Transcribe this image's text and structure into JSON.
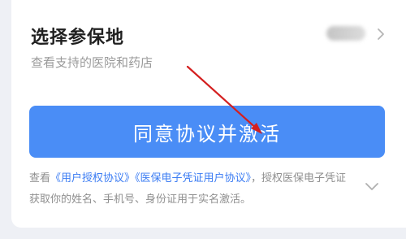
{
  "insurance_location": {
    "title": "选择参保地",
    "subtitle": "查看支持的医院和药店",
    "selected_value": "北京"
  },
  "activate_button": {
    "label": "同意协议并激活"
  },
  "agreement": {
    "prefix": "查看",
    "link1": "《用户授权协议》",
    "link2": "《医保电子凭证用户协议》",
    "suffix": "，授权医保电子凭证获取你的姓名、手机号、身份证用于实名激活。"
  },
  "colors": {
    "accent": "#4a8df6",
    "link": "#3b7cf3",
    "annotation_arrow": "#d42020"
  },
  "icons": {
    "region_chevron": "chevron-right-icon",
    "agreement_expand": "chevron-down-icon",
    "annotation": "red-arrow-icon"
  }
}
